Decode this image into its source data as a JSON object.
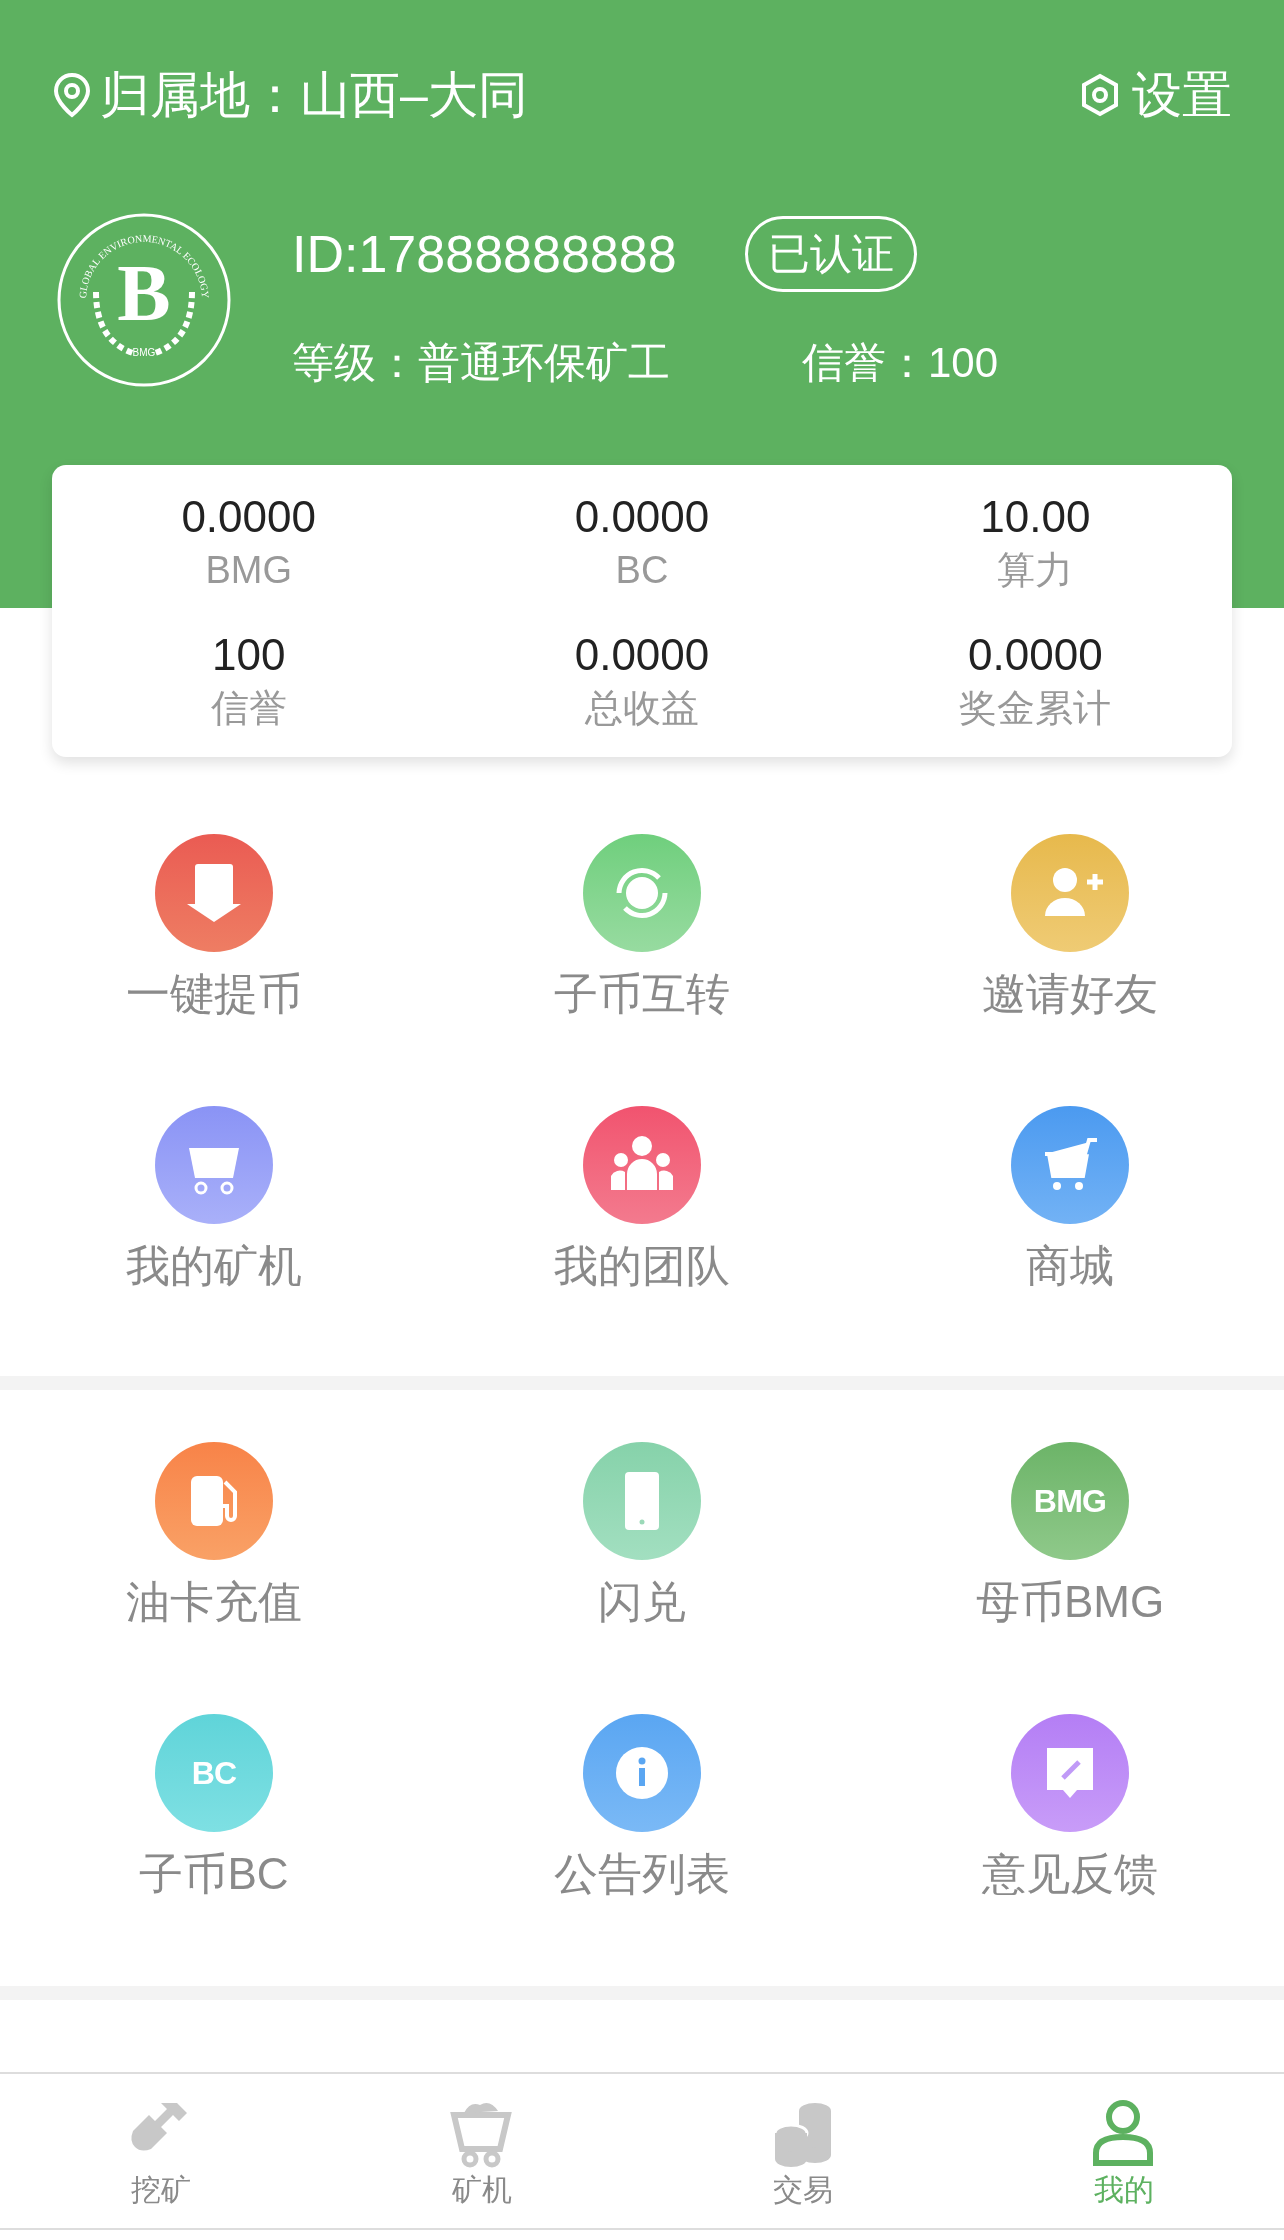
{
  "header": {
    "location": "归属地：山西–大同",
    "settings": "设置"
  },
  "profile": {
    "logo": {
      "ring_text": "GLOBAL ENVIRONMENTAL ECOLOGY",
      "mark": "B",
      "caption": "BMG"
    },
    "id": "ID:17888888888",
    "verified_badge": "已认证",
    "level": "等级：普通环保矿工",
    "credit": "信誉：100"
  },
  "stats": [
    {
      "value": "0.0000",
      "label": "BMG"
    },
    {
      "value": "0.0000",
      "label": "BC"
    },
    {
      "value": "10.00",
      "label": "算力"
    },
    {
      "value": "100",
      "label": "信誉"
    },
    {
      "value": "0.0000",
      "label": "总收益"
    },
    {
      "value": "0.0000",
      "label": "奖金累计"
    }
  ],
  "menu_sections": [
    {
      "items": [
        {
          "label": "一键提币",
          "kind": "withdraw"
        },
        {
          "label": "子币互转",
          "kind": "transfer"
        },
        {
          "label": "邀请好友",
          "kind": "invite"
        },
        {
          "label": "我的矿机",
          "kind": "minecart"
        },
        {
          "label": "我的团队",
          "kind": "team"
        },
        {
          "label": "商城",
          "kind": "cart"
        }
      ]
    },
    {
      "items": [
        {
          "label": "油卡充值",
          "kind": "fuel"
        },
        {
          "label": "闪兑",
          "kind": "phone"
        },
        {
          "label": "母币BMG",
          "kind": "text",
          "icon_text": "BMG"
        },
        {
          "label": "子币BC",
          "kind": "text2",
          "icon_text": "BC"
        },
        {
          "label": "公告列表",
          "kind": "info"
        },
        {
          "label": "意见反馈",
          "kind": "feedback"
        }
      ]
    }
  ],
  "bottom_nav": [
    {
      "label": "挖矿",
      "kind": "shovel",
      "selected": false
    },
    {
      "label": "矿机",
      "kind": "minecart",
      "selected": false
    },
    {
      "label": "交易",
      "kind": "coins",
      "selected": false
    },
    {
      "label": "我的",
      "kind": "person",
      "selected": true
    }
  ]
}
